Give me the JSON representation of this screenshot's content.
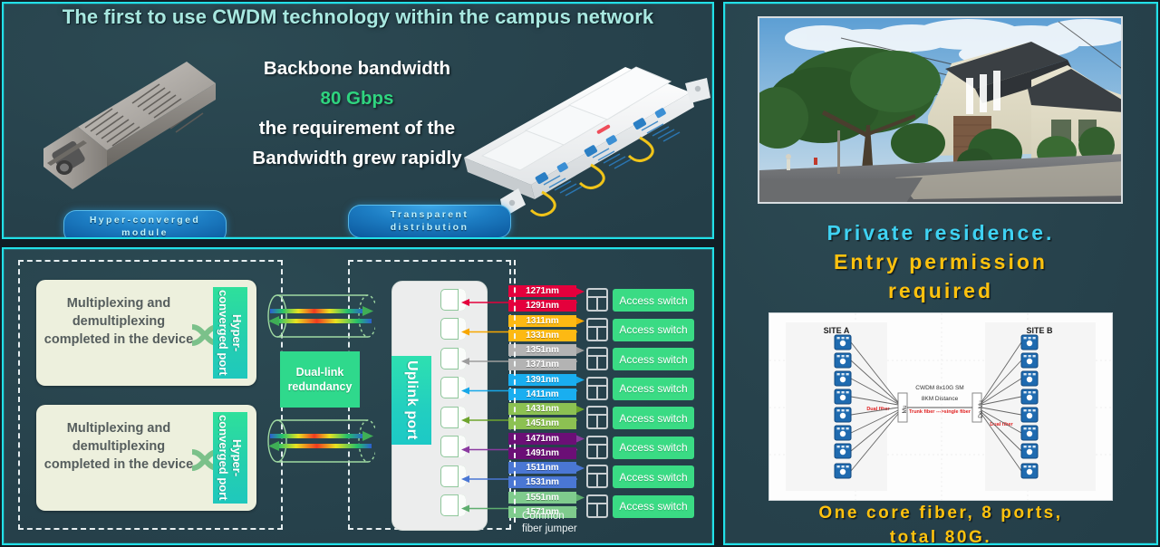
{
  "hero": {
    "title": "The first to use CWDM technology within the campus network",
    "line1": "Backbone bandwidth",
    "line2": "80 Gbps",
    "line3": "the requirement of the",
    "line4": "Bandwidth grew rapidly",
    "badge_left": "Hyper-converged module",
    "badge_right": "Transparent distribution",
    "accent_green": "#2fd47f",
    "title_color": "#a8e8e0"
  },
  "diagram": {
    "mux_cards": [
      {
        "text": "Multiplexing and demultiplexing completed in the device",
        "port_label": "Hyper-converged port"
      },
      {
        "text": "Multiplexing and demultiplexing completed in the device",
        "port_label": "Hyper-converged port"
      }
    ],
    "dual_link_label": "Dual-link redundancy",
    "uplink_label": "Uplink port",
    "jumper_label_line1": "Common",
    "jumper_label_line2": "fiber jumper",
    "access_switch_label": "Access switch",
    "access_switch_count": 8,
    "wavelength_pairs": [
      {
        "a": "1271nm",
        "b": "1291nm",
        "color": "#e4003c",
        "arrow": "#e4003c"
      },
      {
        "a": "1311nm",
        "b": "1331nm",
        "color": "#fdb913",
        "arrow": "#f7a700"
      },
      {
        "a": "1351nm",
        "b": "1371nm",
        "color": "#b3b3b3",
        "arrow": "#9d9d9d"
      },
      {
        "a": "1391nm",
        "b": "1411nm",
        "color": "#19aef0",
        "arrow": "#17a8e8"
      },
      {
        "a": "1431nm",
        "b": "1451nm",
        "color": "#8cc152",
        "arrow": "#6fa52e"
      },
      {
        "a": "1471nm",
        "b": "1491nm",
        "color": "#6b0f76",
        "arrow": "#8b3aa0"
      },
      {
        "a": "1511nm",
        "b": "1531nm",
        "color": "#4a77d4",
        "arrow": "#4a77d4"
      },
      {
        "a": "1551nm",
        "b": "1571nm",
        "color": "#7fcb8d",
        "arrow": "#5fae6f"
      }
    ]
  },
  "right": {
    "headline_line1": "Private residence.",
    "headline_line2": "Entry permission",
    "headline_line3": "required",
    "footer_line1": "One core fiber, 8 ports,",
    "footer_line2": "total 80G.",
    "headline_cyan": "#3fd2f2",
    "headline_amber": "#ffc20e",
    "site_diagram": {
      "site_a": "SITE A",
      "site_b": "SITE B",
      "spec_line1": "CWDM 8x10G SM",
      "spec_line2": "8KM Distance",
      "mux_label": "Mu",
      "demux_label": "De-Mu",
      "trunk_label": "Trunk fiber --->single fiber",
      "dual_fiber_left": "Dual fiber",
      "dual_fiber_right": "Dual fiber",
      "switch_count_per_site": 8
    }
  }
}
